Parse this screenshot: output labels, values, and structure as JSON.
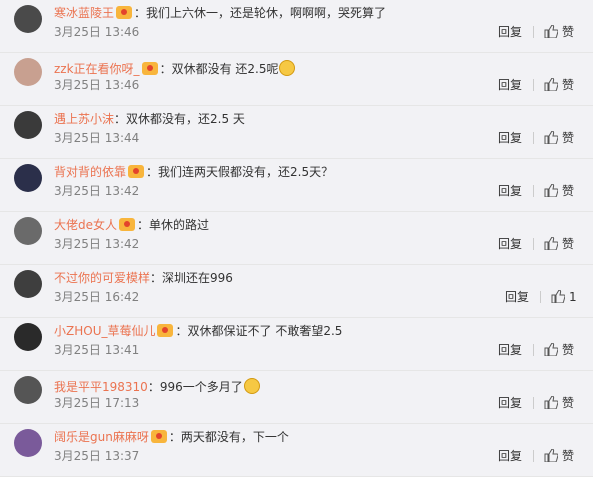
{
  "ui": {
    "reply_label": "回复",
    "like_label": "赞",
    "colon": "："
  },
  "comments": [
    {
      "user": "寒冰蓝陵王",
      "text": "我们上六休一，还是轮休，啊啊啊，哭死算了",
      "date": "3月25日",
      "time": "13:46",
      "likes": "",
      "emoji": false,
      "avatar_color": "#4a4a4a"
    },
    {
      "user": "zzk正在看你呀_",
      "text": "双休都没有 还2.5呢",
      "date": "3月25日",
      "time": "13:46",
      "likes": "",
      "emoji": true,
      "avatar_color": "#c8a090"
    },
    {
      "user": "遇上苏小沫",
      "text": "双休都没有，还2.5 天",
      "date": "3月25日",
      "time": "13:44",
      "likes": "",
      "emoji": false,
      "avatar_color": "#3a3a3a"
    },
    {
      "user": "背对背的依靠",
      "text": "我们连两天假都没有，还2.5天？",
      "date": "3月25日",
      "time": "13:42",
      "likes": "",
      "emoji": false,
      "avatar_color": "#2b2f4a"
    },
    {
      "user": "大佬de女人",
      "text": "单休的路过",
      "date": "3月25日",
      "time": "13:42",
      "likes": "",
      "emoji": false,
      "avatar_color": "#6a6a6a"
    },
    {
      "user": "不过你的可爱模样",
      "text": "深圳还在996",
      "date": "3月25日",
      "time": "16:42",
      "likes": "1",
      "emoji": false,
      "avatar_color": "#3e3e3e"
    },
    {
      "user": "小ZHOU_草莓仙儿",
      "text": "双休都保证不了  不敢奢望2.5",
      "date": "3月25日",
      "time": "13:41",
      "likes": "",
      "emoji": false,
      "avatar_color": "#2a2a2a"
    },
    {
      "user": "我是平平198310",
      "text": "996一个多月了",
      "date": "3月25日",
      "time": "17:13",
      "likes": "",
      "emoji": true,
      "avatar_color": "#555555"
    },
    {
      "user": "阔乐是gun麻麻呀",
      "text": "两天都没有，下一个",
      "date": "3月25日",
      "time": "13:37",
      "likes": "",
      "emoji": false,
      "avatar_color": "#7a5a9a"
    }
  ]
}
